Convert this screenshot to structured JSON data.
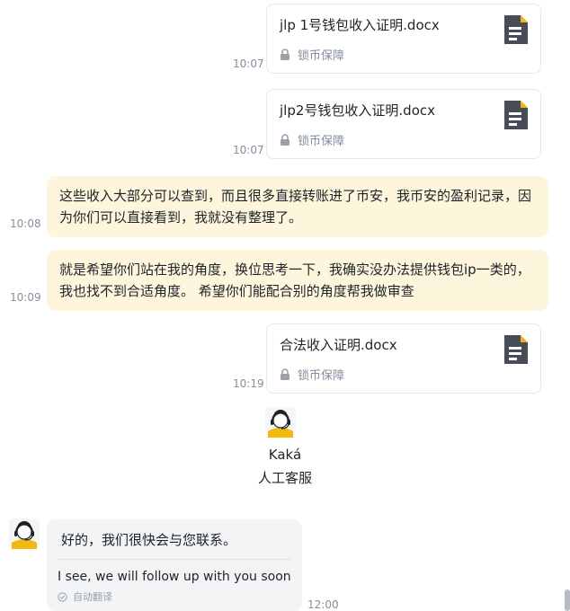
{
  "messages": {
    "file1": {
      "name": "jlp 1号钱包收入证明.docx",
      "protection": "锁币保障",
      "time": "10:07"
    },
    "file2": {
      "name": "jlp2号钱包收入证明.docx",
      "protection": "锁币保障",
      "time": "10:07"
    },
    "text1": {
      "text": "这些收入大部分可以查到，而且很多直接转账进了币安，我币安的盈利记录，因为你们可以直接看到，我就没有整理了。",
      "time": "10:08"
    },
    "text2": {
      "text": "就是希望你们站在我的角度，换位思考一下，我确实没办法提供钱包ip一类的，我也找不到合适角度。 希望你们能配合别的角度帮我做审查",
      "time": "10:09"
    },
    "file3": {
      "name": "合法收入证明.docx",
      "protection": "锁币保障",
      "time": "10:19"
    }
  },
  "agent": {
    "name": "Kaká",
    "role": "人工客服"
  },
  "reply": {
    "text_cn": "好的，我们很快会与您联系。",
    "text_en": "I see, we will follow up with you soon",
    "translate_label": "自动翻译",
    "time": "12:00"
  },
  "icons": {
    "file": "document-icon",
    "lock": "lock-icon",
    "avatar": "support-agent-avatar",
    "translate": "check-circle-icon"
  },
  "colors": {
    "user_bubble": "#fdf6dc",
    "agent_bubble": "#f3f4f5",
    "brand_yellow": "#f0b90b",
    "icon_dark": "#474d57",
    "muted_text": "#848e9c"
  }
}
